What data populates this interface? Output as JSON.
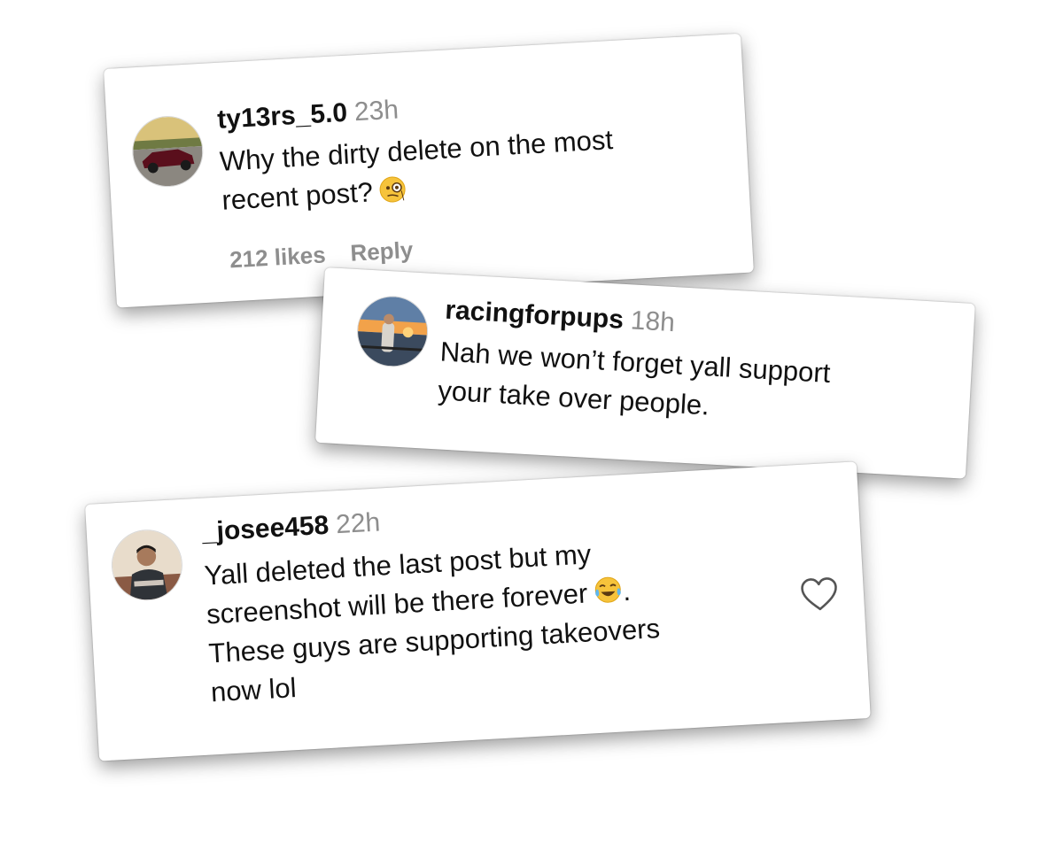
{
  "comments": [
    {
      "username": "ty13rs_5.0",
      "time": "23h",
      "text_lines": [
        "Why the dirty delete on the most",
        "recent post?"
      ],
      "emoji": "face-with-monocle",
      "likes": "212 likes",
      "reply": "Reply"
    },
    {
      "username": "racingforpups",
      "time": "18h",
      "text_lines": [
        "Nah we won’t forget yall support",
        "your take over people."
      ]
    },
    {
      "username": "_josee458",
      "time": "22h",
      "text_lines": [
        "Yall deleted the last post but my",
        "screenshot will be there forever",
        "These guys are supporting takeovers",
        "now lol"
      ],
      "emoji": "face-with-tears-of-joy",
      "emoji_suffix": ".",
      "like_icon": "heart-outline-icon"
    }
  ],
  "colors": {
    "username": "#111111",
    "secondary": "#8e8e8e",
    "card_bg": "#ffffff"
  }
}
